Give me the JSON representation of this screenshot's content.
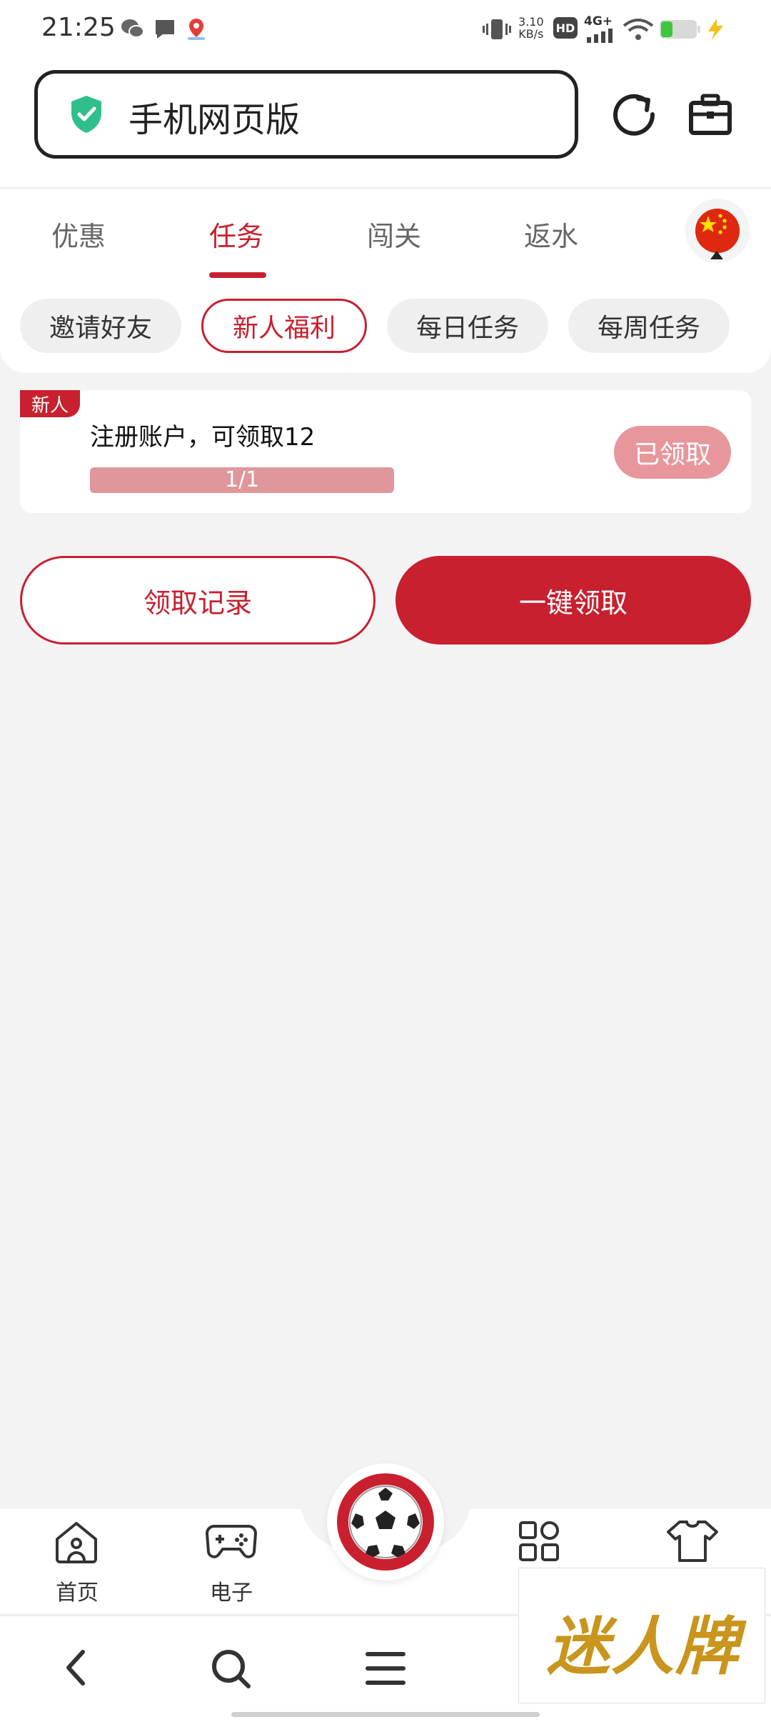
{
  "status_bar": {
    "time": "21:25",
    "speed_value": "3.10",
    "speed_unit": "KB/s",
    "hd_label": "HD",
    "network_label": "4G+"
  },
  "browser": {
    "url_text": "手机网页版"
  },
  "tabs": [
    {
      "label": "优惠",
      "active": false
    },
    {
      "label": "任务",
      "active": true
    },
    {
      "label": "闯关",
      "active": false
    },
    {
      "label": "返水",
      "active": false
    }
  ],
  "sub_tabs": [
    {
      "label": "邀请好友",
      "active": false
    },
    {
      "label": "新人福利",
      "active": true
    },
    {
      "label": "每日任务",
      "active": false
    },
    {
      "label": "每周任务",
      "active": false
    }
  ],
  "task": {
    "badge": "新人",
    "title": "注册账户，可领取12",
    "progress_text": "1/1",
    "progress_fraction": 1.0,
    "status_label": "已领取"
  },
  "actions": {
    "record_label": "领取记录",
    "claim_all_label": "一键领取"
  },
  "bottom_nav": {
    "home_label": "首页",
    "games_label": "电子"
  },
  "watermark_text": "迷人牌",
  "colors": {
    "accent": "#c8202f",
    "claimed": "#e7979c",
    "background": "#f3f3f3"
  }
}
